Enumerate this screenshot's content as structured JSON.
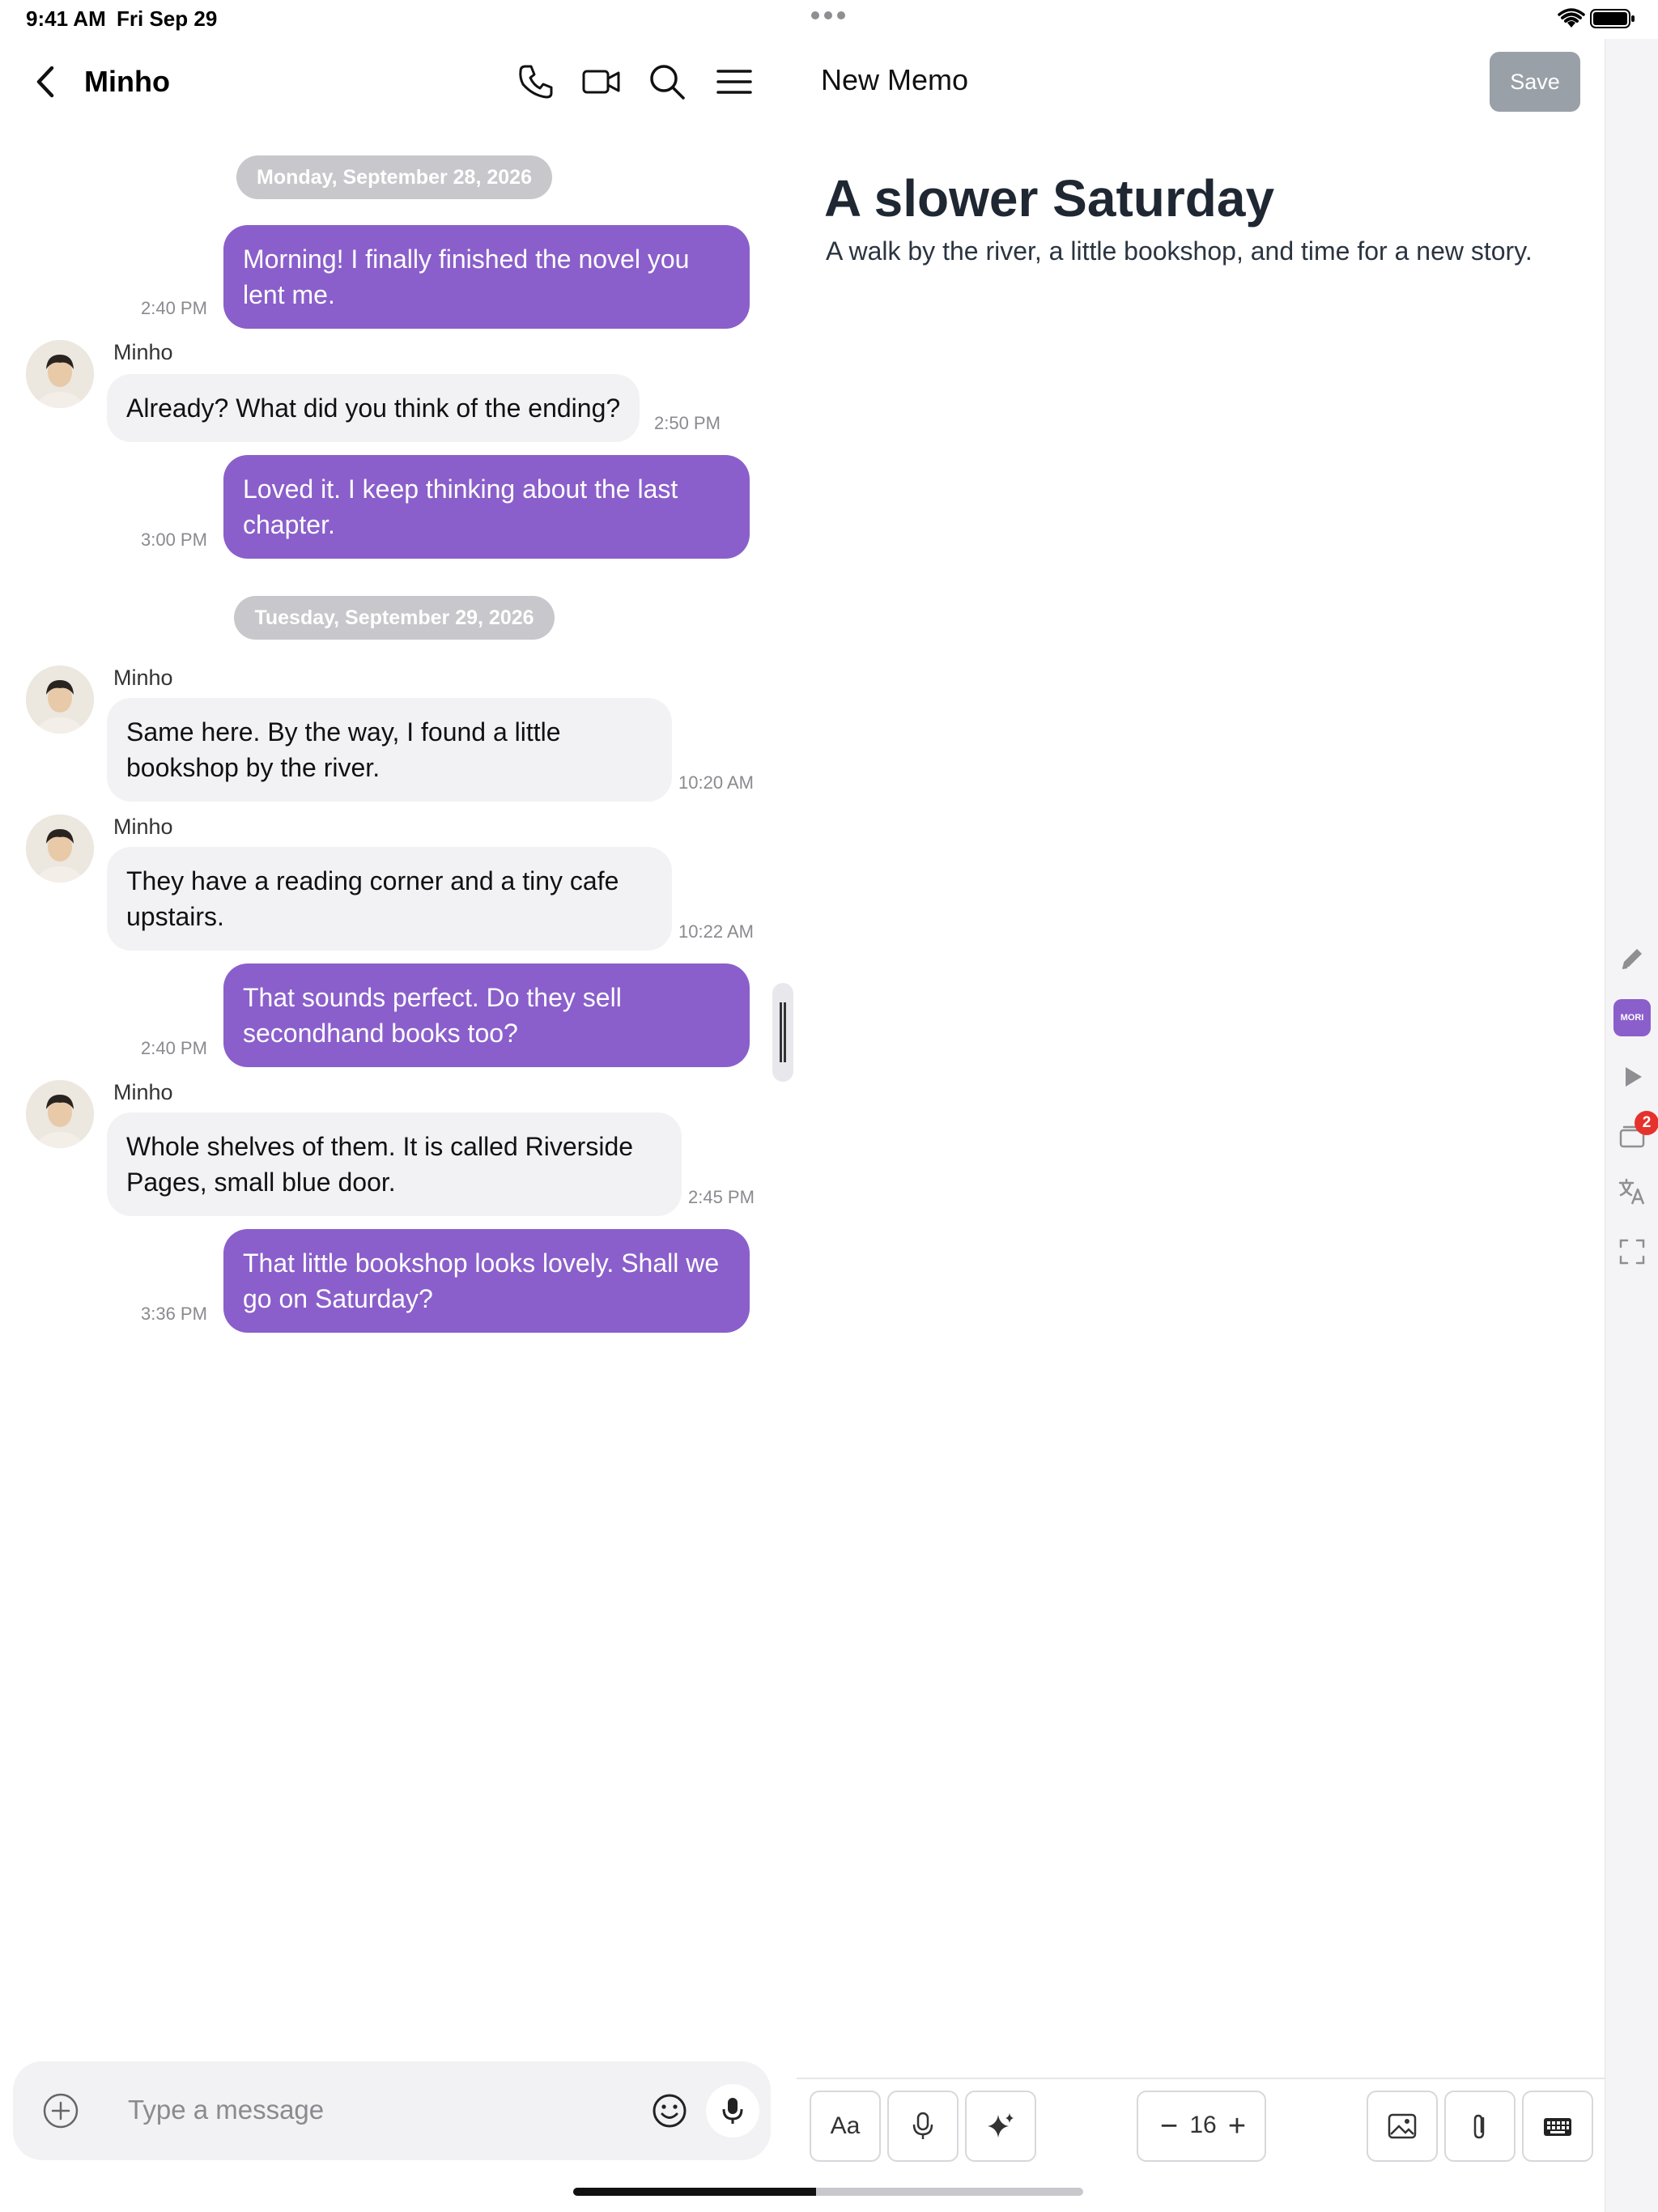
{
  "status_bar": {
    "time": "9:41 AM",
    "date": "Fri Sep 29"
  },
  "chat": {
    "contact_name": "Minho",
    "date_separators": [
      "Monday, September 28, 2026",
      "Tuesday, September 29, 2026"
    ],
    "messages": [
      {
        "direction": "out",
        "text": "Morning! I finally finished the novel you lent me.",
        "time": "2:40 PM"
      },
      {
        "direction": "in",
        "sender": "Minho",
        "text": "Already? What did you think of the ending?",
        "time": "2:50 PM"
      },
      {
        "direction": "out",
        "text": "Loved it. I keep thinking about the last chapter.",
        "time": "3:00 PM"
      },
      {
        "direction": "in",
        "sender": "Minho",
        "text": "Same here. By the way, I found a little bookshop by the river.",
        "time": "10:20 AM"
      },
      {
        "direction": "in",
        "sender": "Minho",
        "text": "They have a reading corner and a tiny cafe upstairs.",
        "time": "10:22 AM"
      },
      {
        "direction": "out",
        "text": "That sounds perfect. Do they sell secondhand books too?",
        "time": "2:40 PM"
      },
      {
        "direction": "in",
        "sender": "Minho",
        "text": "Whole shelves of them. It is called Riverside Pages, small blue door.",
        "time": "2:45 PM"
      },
      {
        "direction": "out",
        "text": "That little bookshop looks lovely. Shall we go on Saturday?",
        "time": "3:36 PM"
      }
    ],
    "composer": {
      "placeholder": "Type a message",
      "value": ""
    }
  },
  "memo": {
    "header_title": "New Memo",
    "save_label": "Save",
    "heading": "A slower Saturday",
    "body": "A walk by the river, a little bookshop, and time for a new story.",
    "toolbar": {
      "font_label": "Aa",
      "font_size": "16"
    }
  },
  "side_rail": {
    "app_badge_label": "MORI",
    "notification_count": "2"
  },
  "colors": {
    "accent": "#8a5fcb",
    "incoming_bubble": "#f2f2f4",
    "save_disabled": "#9aa0a8"
  }
}
